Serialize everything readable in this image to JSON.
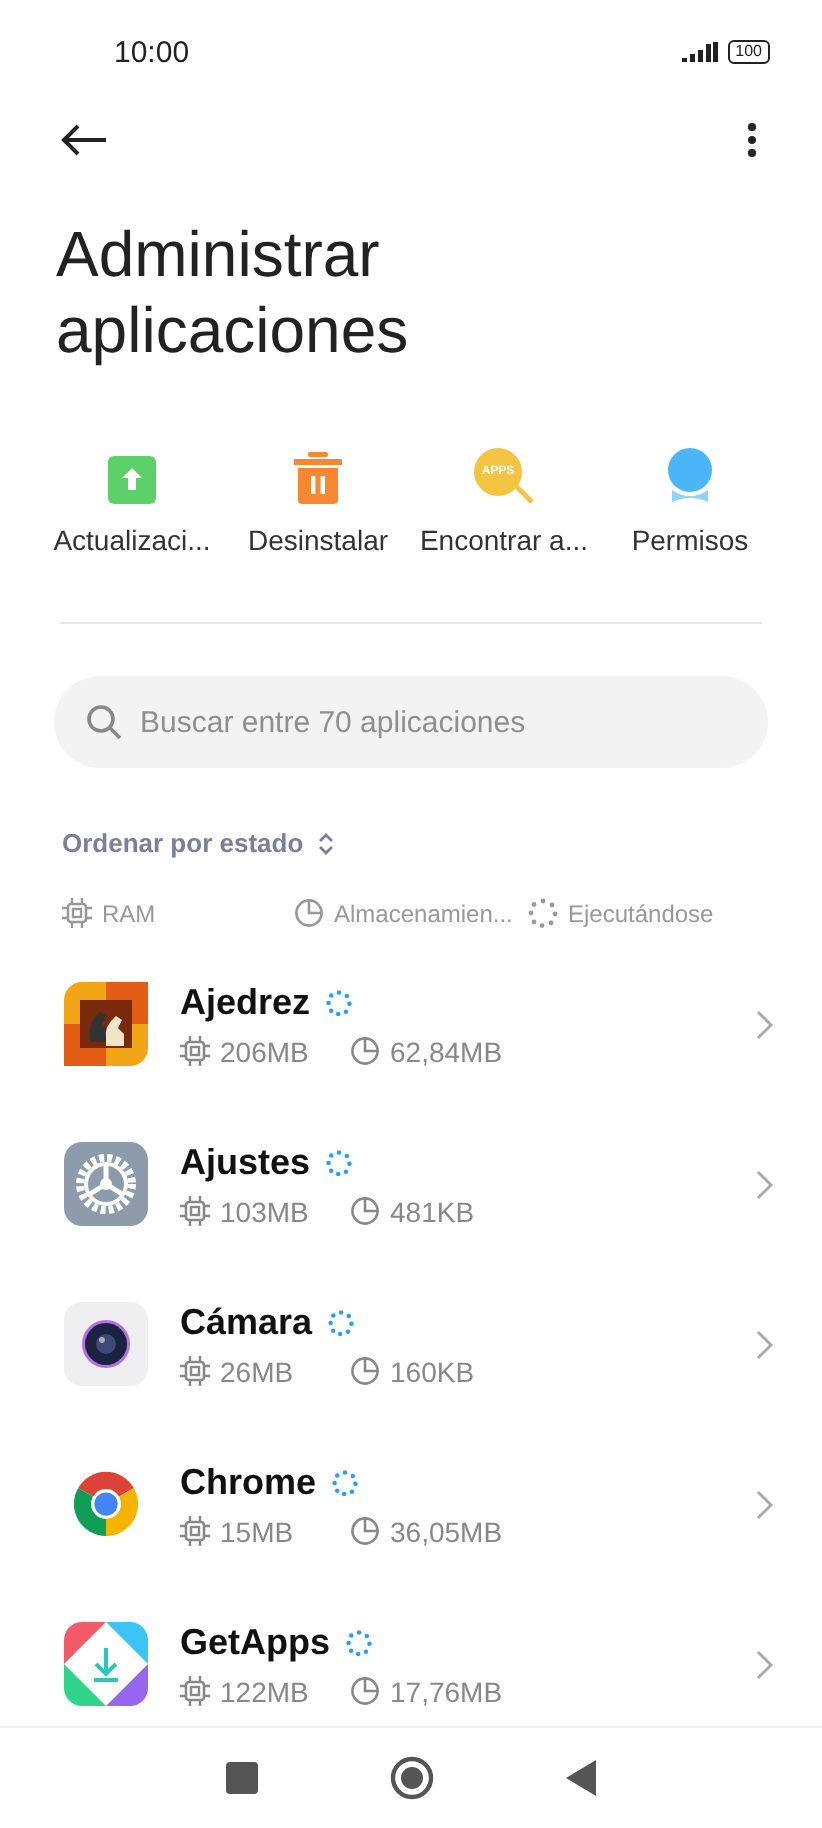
{
  "status_bar": {
    "time": "10:00",
    "battery": "100"
  },
  "title": "Administrar aplicaciones",
  "actions": [
    {
      "kind": "update",
      "label": "Actualizaci..."
    },
    {
      "kind": "uninstall",
      "label": "Desinstalar"
    },
    {
      "kind": "find",
      "label": "Encontrar a...",
      "badge": "APPS"
    },
    {
      "kind": "permissions",
      "label": "Permisos"
    }
  ],
  "search": {
    "placeholder": "Buscar entre 70 aplicaciones"
  },
  "sort": {
    "label": "Ordenar por estado"
  },
  "legend": [
    {
      "kind": "ram",
      "label": "RAM"
    },
    {
      "kind": "storage",
      "label": "Almacenamien..."
    },
    {
      "kind": "running",
      "label": "Ejecutándose"
    }
  ],
  "apps": [
    {
      "kind": "chess",
      "name": "Ajedrez",
      "running": true,
      "ram": "206MB",
      "storage": "62,84MB"
    },
    {
      "kind": "settings",
      "name": "Ajustes",
      "running": true,
      "ram": "103MB",
      "storage": "481KB"
    },
    {
      "kind": "camera",
      "name": "Cámara",
      "running": true,
      "ram": "26MB",
      "storage": "160KB"
    },
    {
      "kind": "browser",
      "name": "Chrome",
      "running": true,
      "ram": "15MB",
      "storage": "36,05MB"
    },
    {
      "kind": "store",
      "name": "GetApps",
      "running": true,
      "ram": "122MB",
      "storage": "17,76MB"
    }
  ]
}
